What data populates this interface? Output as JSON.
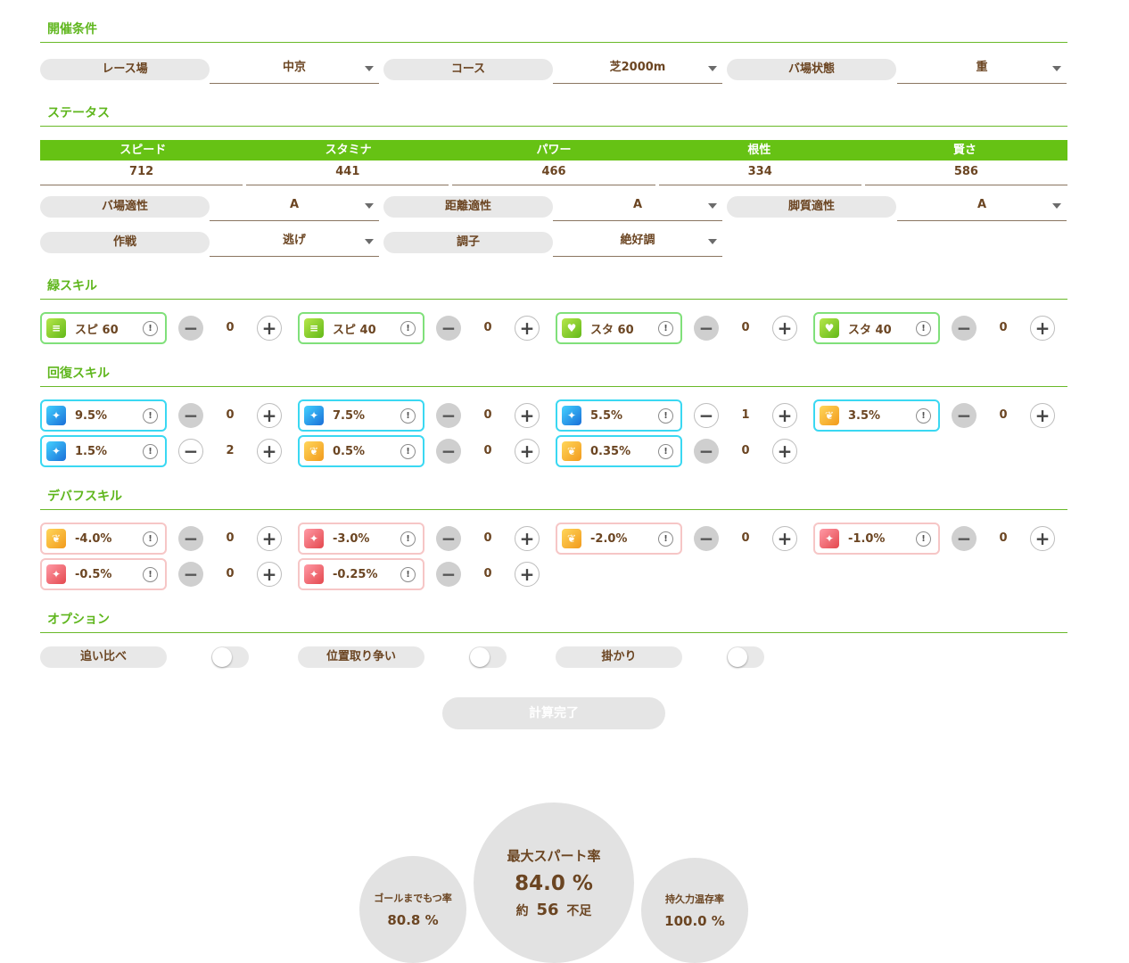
{
  "sections": {
    "conditions": "開催条件",
    "status": "ステータス",
    "green_skills": "緑スキル",
    "recovery_skills": "回復スキル",
    "debuff_skills": "デバフスキル",
    "options": "オプション"
  },
  "conditions": {
    "race_track_label": "レース場",
    "race_track_value": "中京",
    "course_label": "コース",
    "course_value": "芝2000m",
    "ground_label": "バ場状態",
    "ground_value": "重"
  },
  "status": {
    "headers": [
      "スピード",
      "スタミナ",
      "パワー",
      "根性",
      "賢さ"
    ],
    "values": [
      "712",
      "441",
      "466",
      "334",
      "586"
    ],
    "aptitudes": [
      {
        "label": "バ場適性",
        "value": "A"
      },
      {
        "label": "距離適性",
        "value": "A"
      },
      {
        "label": "脚質適性",
        "value": "A"
      }
    ],
    "strategy_label": "作戦",
    "strategy_value": "逃げ",
    "mood_label": "調子",
    "mood_value": "絶好調"
  },
  "green_skills": [
    {
      "name": "スピ 60",
      "count": "0",
      "icon": "speed-icon"
    },
    {
      "name": "スピ 40",
      "count": "0",
      "icon": "speed-icon"
    },
    {
      "name": "スタ 60",
      "count": "0",
      "icon": "heart-icon"
    },
    {
      "name": "スタ 40",
      "count": "0",
      "icon": "heart-icon"
    }
  ],
  "recovery_skills": [
    {
      "name": "9.5%",
      "count": "0",
      "icon": "sparkle-blue-icon"
    },
    {
      "name": "7.5%",
      "count": "0",
      "icon": "sparkle-blue-icon"
    },
    {
      "name": "5.5%",
      "count": "1",
      "icon": "sparkle-blue-icon"
    },
    {
      "name": "3.5%",
      "count": "0",
      "icon": "wing-orange-icon"
    },
    {
      "name": "1.5%",
      "count": "2",
      "icon": "sparkle-blue-icon"
    },
    {
      "name": "0.5%",
      "count": "0",
      "icon": "wing-orange-icon"
    },
    {
      "name": "0.35%",
      "count": "0",
      "icon": "wing-orange-icon"
    }
  ],
  "debuff_skills": [
    {
      "name": "-4.0%",
      "count": "0",
      "icon": "wing-orange-icon"
    },
    {
      "name": "-3.0%",
      "count": "0",
      "icon": "sparkle-red-icon"
    },
    {
      "name": "-2.0%",
      "count": "0",
      "icon": "wing-orange-icon"
    },
    {
      "name": "-1.0%",
      "count": "0",
      "icon": "sparkle-red-icon"
    },
    {
      "name": "-0.5%",
      "count": "0",
      "icon": "sparkle-red-icon"
    },
    {
      "name": "-0.25%",
      "count": "0",
      "icon": "sparkle-red-icon"
    }
  ],
  "options": [
    {
      "label": "追い比べ",
      "on": false
    },
    {
      "label": "位置取り争い",
      "on": false
    },
    {
      "label": "掛かり",
      "on": false
    }
  ],
  "calc_button": "計算完了",
  "results": {
    "goal_label": "ゴールまでもつ率",
    "goal_value": "80.8 %",
    "max_spurt_label": "最大スパート率",
    "max_spurt_value": "84.0 %",
    "shortfall_prefix": "約",
    "shortfall_value": "56",
    "shortfall_suffix": "不足",
    "stamina_label": "持久力温存率",
    "stamina_value": "100.0 %"
  },
  "colors": {
    "accent_green": "#66c214",
    "text_brown": "#6b4522",
    "recovery_border": "#3ad8f2",
    "green_border": "#80e07a",
    "debuff_border": "#f6c6c6"
  }
}
